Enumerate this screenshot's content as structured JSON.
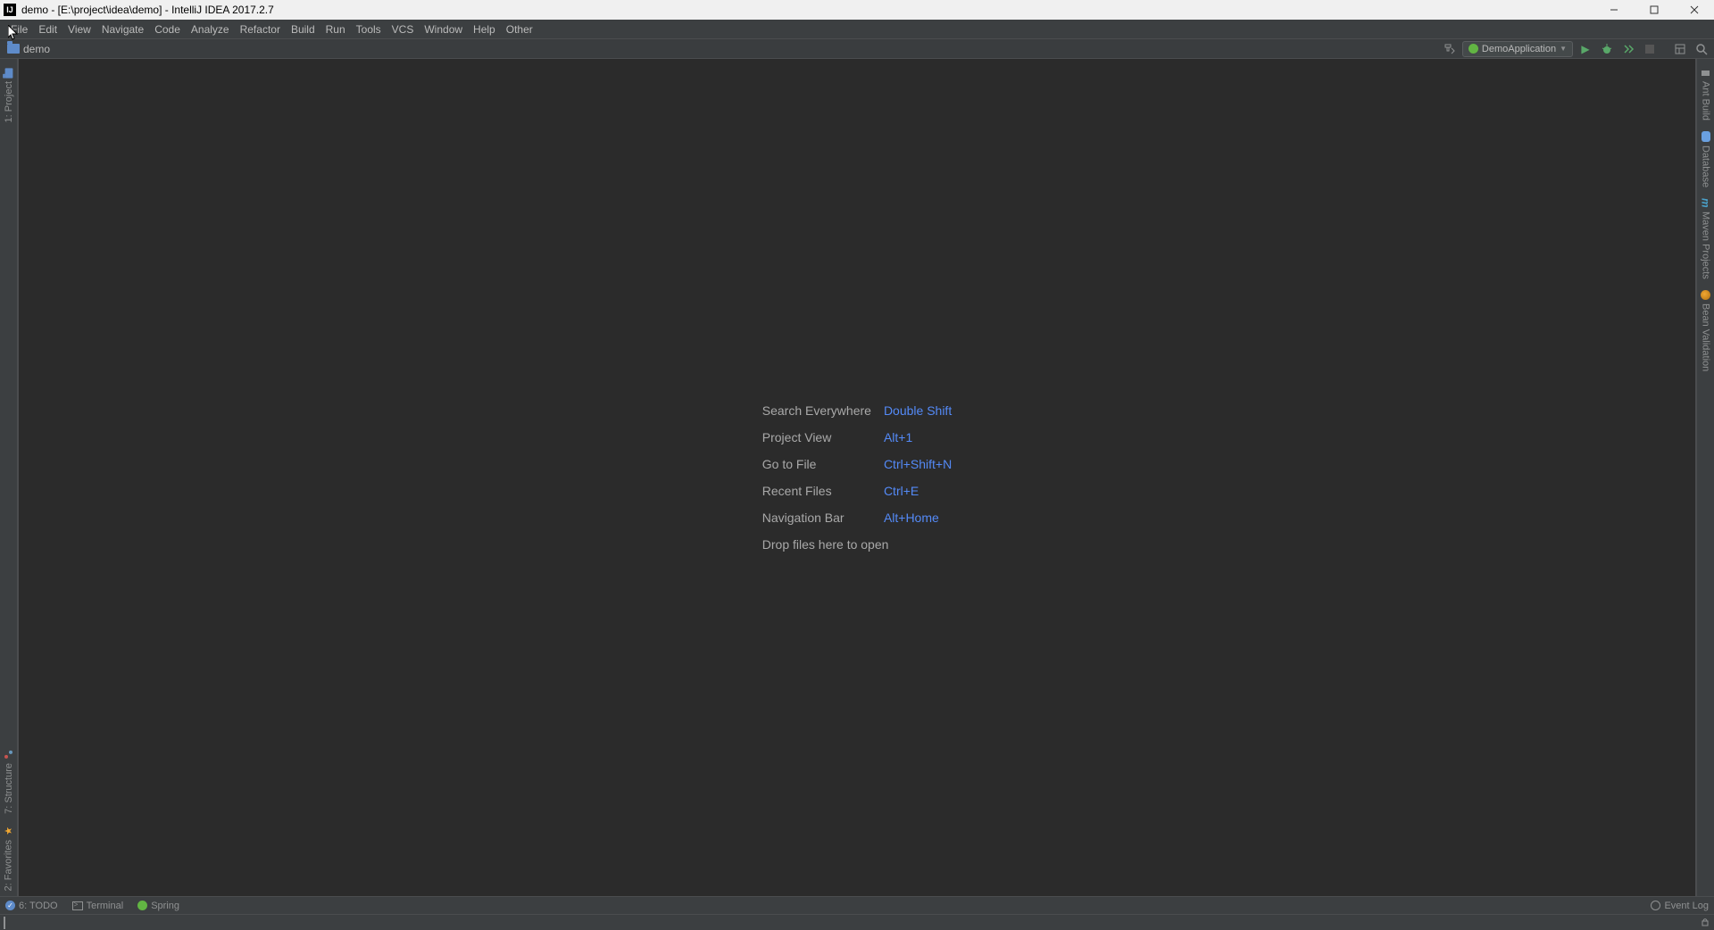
{
  "titlebar": {
    "app_icon_text": "IJ",
    "title": "demo - [E:\\project\\idea\\demo] - IntelliJ IDEA 2017.2.7"
  },
  "menubar": {
    "items": [
      "File",
      "Edit",
      "View",
      "Navigate",
      "Code",
      "Analyze",
      "Refactor",
      "Build",
      "Run",
      "Tools",
      "VCS",
      "Window",
      "Help",
      "Other"
    ]
  },
  "navrow": {
    "breadcrumb": {
      "project": "demo"
    },
    "run_config": {
      "label": "DemoApplication"
    }
  },
  "left_gutter": {
    "project": "1: Project",
    "structure": "7: Structure",
    "favorites": "2: Favorites"
  },
  "right_gutter": {
    "ant": "Ant Build",
    "database": "Database",
    "maven": "Maven Projects",
    "bean": "Bean Validation"
  },
  "editor_hints": {
    "rows": [
      {
        "label": "Search Everywhere",
        "key": "Double Shift"
      },
      {
        "label": "Project View",
        "key": "Alt+1"
      },
      {
        "label": "Go to File",
        "key": "Ctrl+Shift+N"
      },
      {
        "label": "Recent Files",
        "key": "Ctrl+E"
      },
      {
        "label": "Navigation Bar",
        "key": "Alt+Home"
      }
    ],
    "drop": "Drop files here to open"
  },
  "bottombar": {
    "todo": "6: TODO",
    "terminal": "Terminal",
    "spring": "Spring",
    "eventlog": "Event Log"
  }
}
